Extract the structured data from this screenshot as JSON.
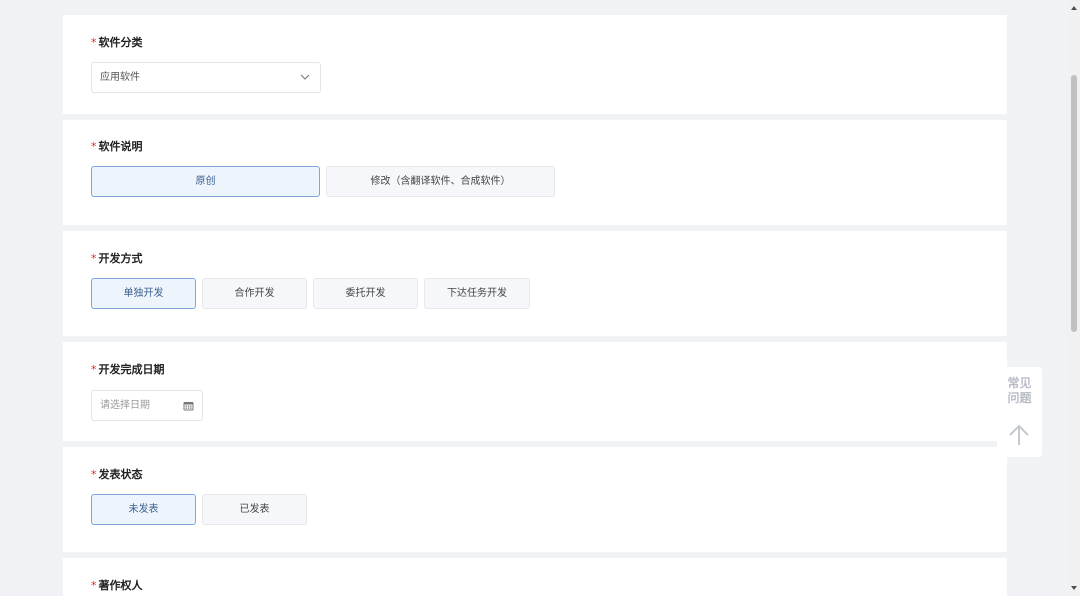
{
  "sections": {
    "category": {
      "label": "软件分类",
      "required_mark": "*",
      "selected": "应用软件"
    },
    "description": {
      "label": "软件说明",
      "required_mark": "*",
      "options": [
        "原创",
        "修改（含翻译软件、合成软件）"
      ],
      "selected_index": 0
    },
    "dev_mode": {
      "label": "开发方式",
      "required_mark": "*",
      "options": [
        "单独开发",
        "合作开发",
        "委托开发",
        "下达任务开发"
      ],
      "selected_index": 0
    },
    "completion_date": {
      "label": "开发完成日期",
      "required_mark": "*",
      "placeholder": "请选择日期"
    },
    "publish_status": {
      "label": "发表状态",
      "required_mark": "*",
      "options": [
        "未发表",
        "已发表"
      ],
      "selected_index": 0
    },
    "copyright_owner": {
      "label": "著作权人",
      "required_mark": "*"
    }
  },
  "float_panel": {
    "faq_line1": "常见",
    "faq_line2": "问题",
    "back_to_top_icon": "arrow-up-icon"
  },
  "colors": {
    "page_bg": "#f0f2f5",
    "card_bg": "#ffffff",
    "required": "#e02424",
    "selected_border": "#7fa6d6",
    "selected_bg": "#eef4fb",
    "accent_tab": "#2196f3"
  }
}
